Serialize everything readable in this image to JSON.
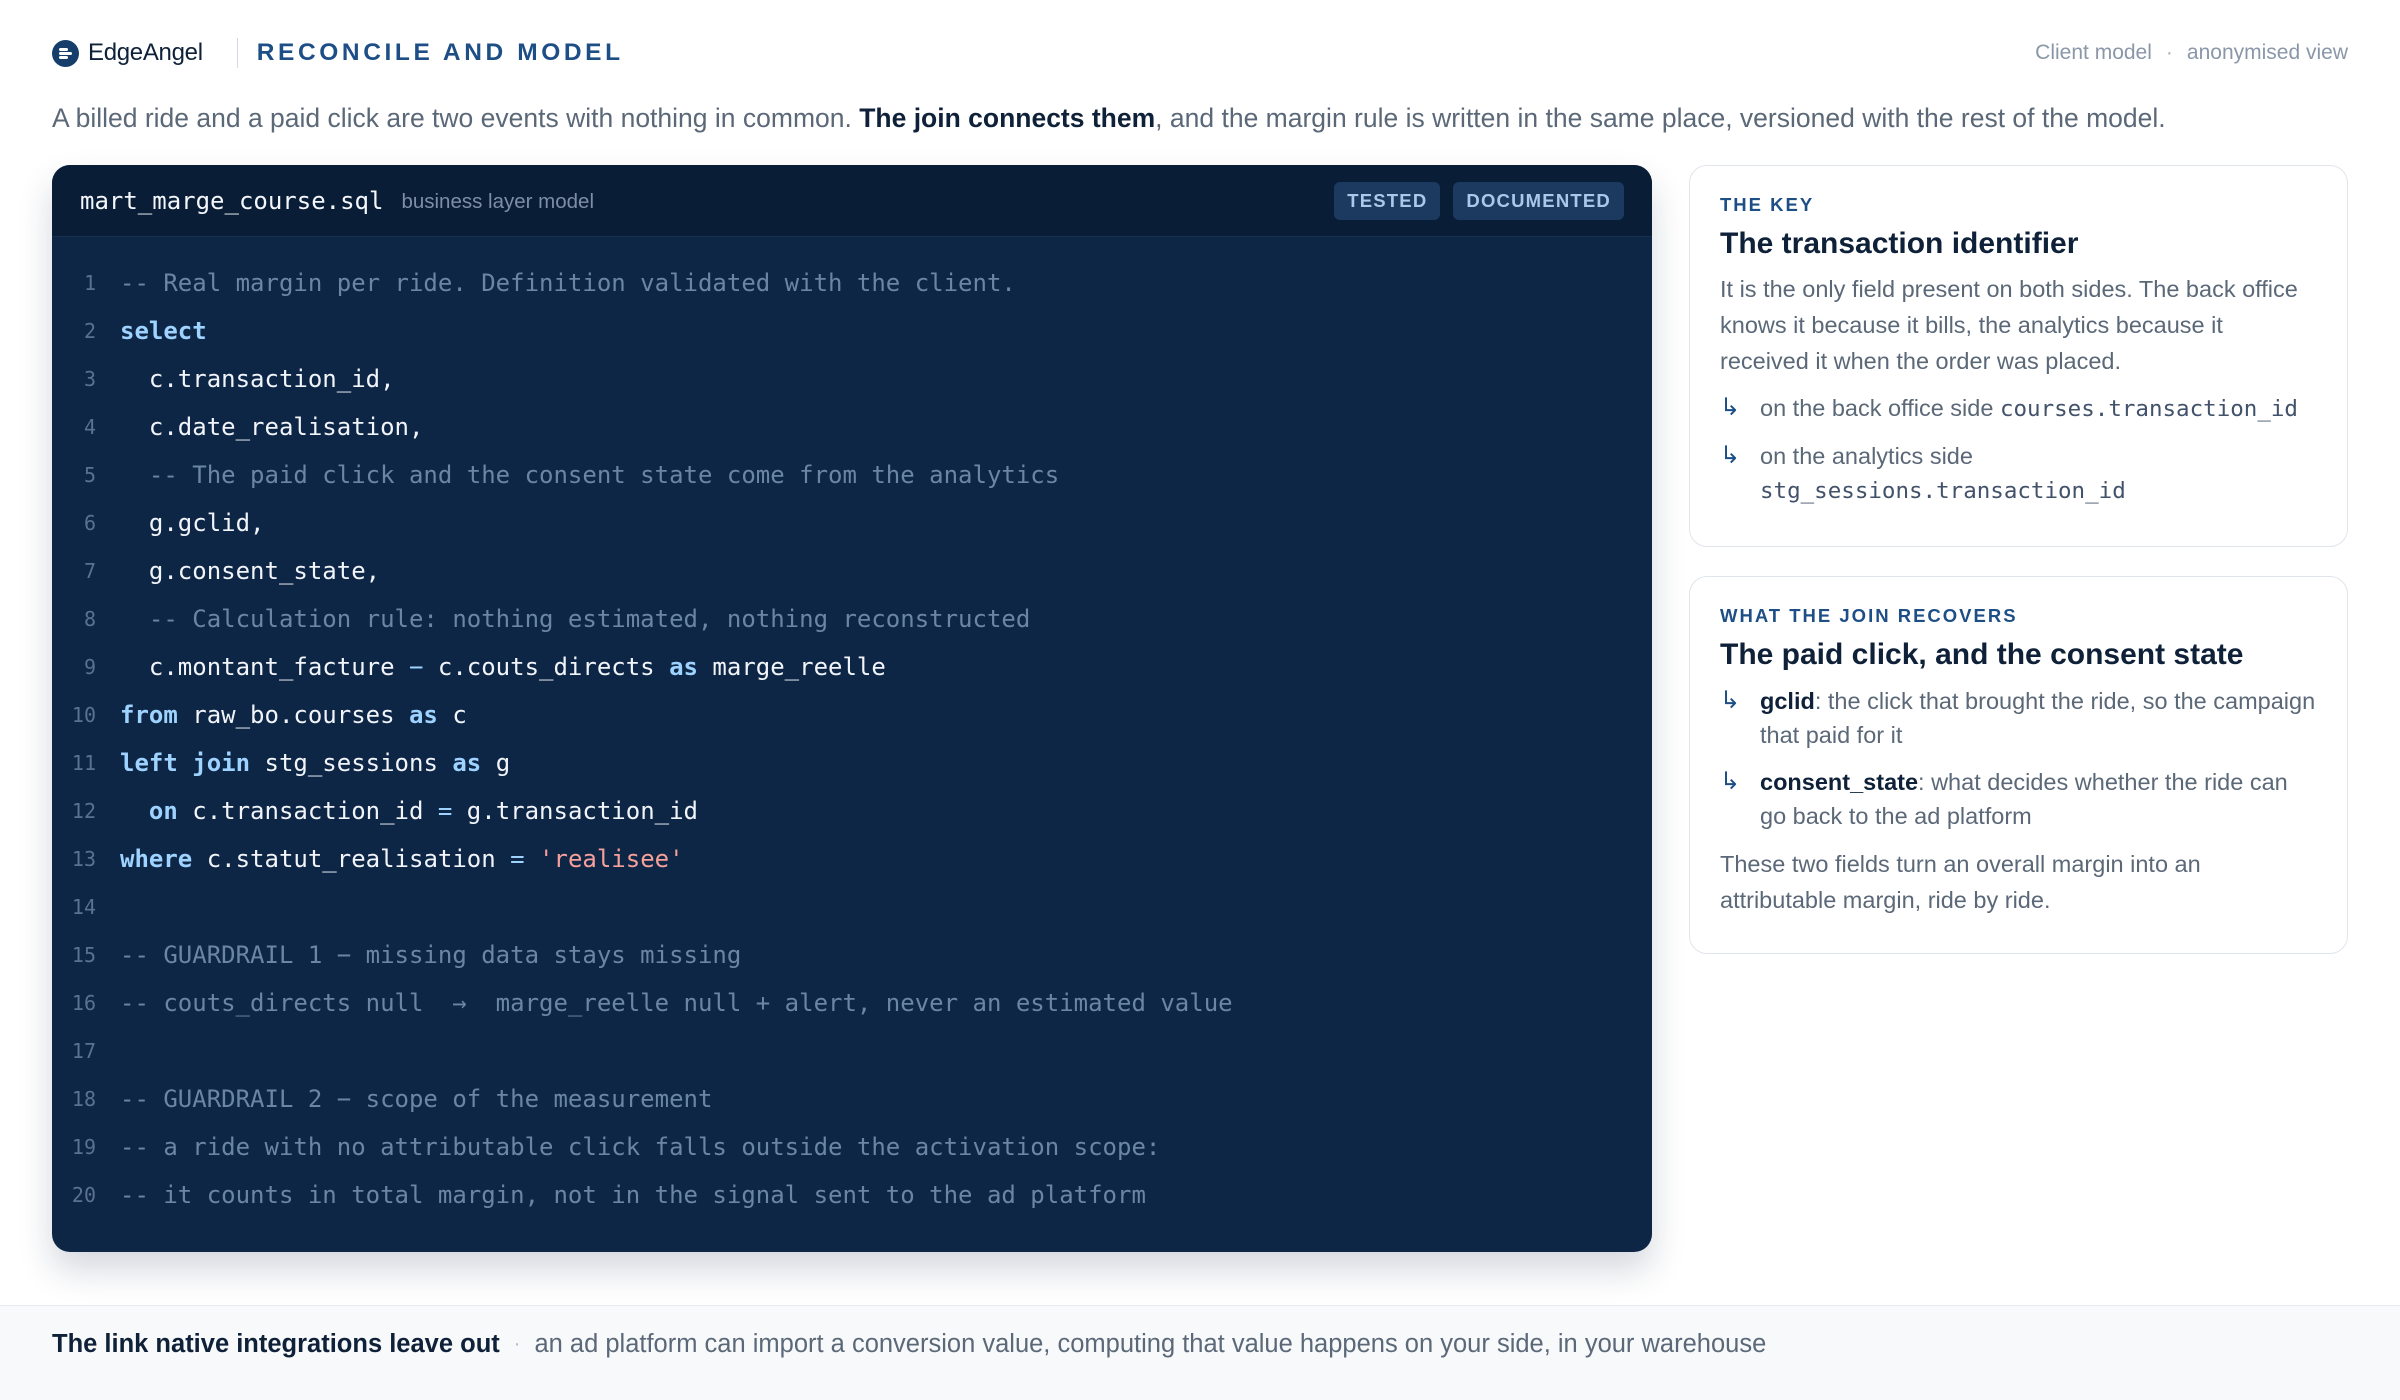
{
  "header": {
    "brand": "EdgeAngel",
    "section_title": "RECONCILE AND MODEL",
    "meta_left": "Client model",
    "meta_sep": "·",
    "meta_right": "anonymised view"
  },
  "intro": {
    "before": "A billed ride and a paid click are two events with nothing in common. ",
    "emphasis": "The join connects them",
    "after": ", and the margin rule is written in the same place, versioned with the rest of the model."
  },
  "code": {
    "file_name": "mart_marge_course.sql",
    "file_kind": "business layer model",
    "badges": [
      "TESTED",
      "DOCUMENTED"
    ],
    "lines": [
      [
        [
          "cm",
          "-- Real margin per ride. Definition validated with the client."
        ]
      ],
      [
        [
          "kw",
          "select"
        ]
      ],
      [
        [
          "tx",
          "  c.transaction_id,"
        ]
      ],
      [
        [
          "tx",
          "  c.date_realisation,"
        ]
      ],
      [
        [
          "cm",
          "  -- The paid click and the consent state come from the analytics"
        ]
      ],
      [
        [
          "tx",
          "  g.gclid,"
        ]
      ],
      [
        [
          "tx",
          "  g.consent_state,"
        ]
      ],
      [
        [
          "cm",
          "  -- Calculation rule: nothing estimated, nothing reconstructed"
        ]
      ],
      [
        [
          "tx",
          "  c.montant_facture "
        ],
        [
          "op",
          "−"
        ],
        [
          "tx",
          " c.couts_directs "
        ],
        [
          "kw",
          "as"
        ],
        [
          "tx",
          " marge_reelle"
        ]
      ],
      [
        [
          "kw",
          "from"
        ],
        [
          "tx",
          " raw_bo.courses "
        ],
        [
          "kw",
          "as"
        ],
        [
          "tx",
          " c"
        ]
      ],
      [
        [
          "kw",
          "left join"
        ],
        [
          "tx",
          " stg_sessions "
        ],
        [
          "kw",
          "as"
        ],
        [
          "tx",
          " g"
        ]
      ],
      [
        [
          "tx",
          "  "
        ],
        [
          "kw",
          "on"
        ],
        [
          "tx",
          " c.transaction_id "
        ],
        [
          "op",
          "="
        ],
        [
          "tx",
          " g.transaction_id"
        ]
      ],
      [
        [
          "kw",
          "where"
        ],
        [
          "tx",
          " c.statut_realisation "
        ],
        [
          "op",
          "="
        ],
        [
          "tx",
          " "
        ],
        [
          "str",
          "'realisee'"
        ]
      ],
      [],
      [
        [
          "cm",
          "-- GUARDRAIL 1 − missing data stays missing"
        ]
      ],
      [
        [
          "cm",
          "-- couts_directs null  →  marge_reelle null + alert, never an estimated value"
        ]
      ],
      [],
      [
        [
          "cm",
          "-- GUARDRAIL 2 − scope of the measurement"
        ]
      ],
      [
        [
          "cm",
          "-- a ride with no attributable click falls outside the activation scope:"
        ]
      ],
      [
        [
          "cm",
          "-- it counts in total margin, not in the signal sent to the ad platform"
        ]
      ]
    ]
  },
  "card_key": {
    "eyebrow": "THE KEY",
    "title": "The transaction identifier",
    "text": "It is the only field present on both sides. The back office knows it because it bills, the analytics because it received it when the order was placed.",
    "items": [
      {
        "label": "on the back office side ",
        "code": "courses.transaction_id"
      },
      {
        "label": "on the analytics side ",
        "code": "stg_sessions.transaction_id"
      }
    ]
  },
  "card_join": {
    "eyebrow": "WHAT THE JOIN RECOVERS",
    "title": "The paid click, and the consent state",
    "items": [
      {
        "key": "gclid",
        "text": ": the click that brought the ride, so the campaign that paid for it"
      },
      {
        "key": "consent_state",
        "text": ": what decides whether the ride can go back to the ad platform"
      }
    ],
    "text": "These two fields turn an overall margin into an attributable margin, ride by ride."
  },
  "footer": {
    "title": "The link native integrations leave out",
    "sep": "·",
    "text": "an ad platform can import a conversion value, computing that value happens on your side, in your warehouse"
  },
  "icons": {
    "brand": "edgeangel-logo-icon",
    "list_arrow": "return-arrow-icon"
  },
  "colors": {
    "accent": "#1d4f86",
    "code_background": "#0e2646",
    "code_keyword": "#9ed2ff",
    "code_comment": "#6b85a6",
    "code_string": "#f5a09a"
  }
}
